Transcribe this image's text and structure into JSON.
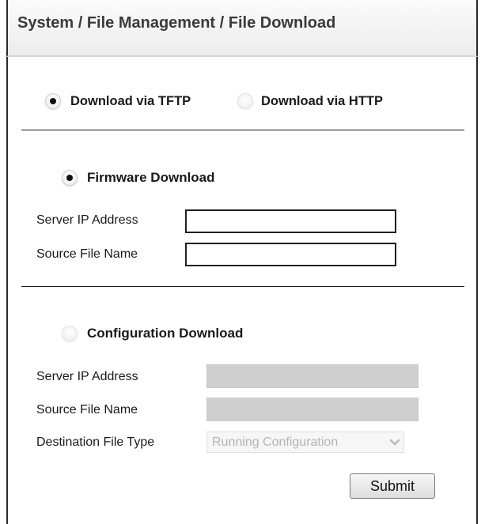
{
  "header": {
    "breadcrumb": "System / File Management / File Download"
  },
  "transfer_mode": {
    "tftp_label": "Download via TFTP",
    "http_label": "Download via HTTP",
    "selected": "tftp"
  },
  "firmware": {
    "title": "Firmware Download",
    "selected": true,
    "server_ip_label": "Server IP Address",
    "server_ip_value": "",
    "source_file_label": "Source File Name",
    "source_file_value": ""
  },
  "configuration": {
    "title": "Configuration Download",
    "selected": false,
    "server_ip_label": "Server IP Address",
    "server_ip_value": "",
    "source_file_label": "Source File Name",
    "source_file_value": "",
    "dest_type_label": "Destination File Type",
    "dest_type_value": "Running Configuration"
  },
  "actions": {
    "submit_label": "Submit"
  }
}
